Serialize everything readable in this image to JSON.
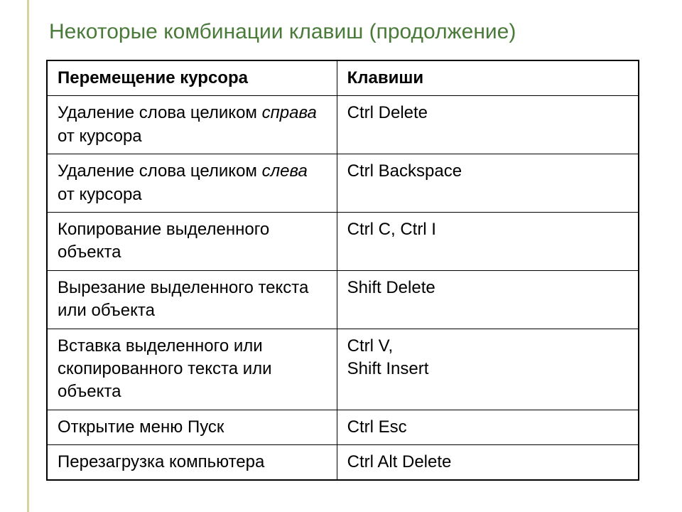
{
  "title": "Некоторые комбинации клавиш (продолжение)",
  "headers": {
    "action": "Перемещение курсора",
    "keys": "Клавиши"
  },
  "rows": [
    {
      "action_pre": "Удаление слова целиком ",
      "action_italic": "справа",
      "action_post": " от курсора",
      "keys": "Ctrl   Delete"
    },
    {
      "action_pre": "Удаление слова целиком ",
      "action_italic": "слева",
      "action_post": " от курсора",
      "keys": "Ctrl   Backspace"
    },
    {
      "action_pre": "Копирование выделенного объекта",
      "action_italic": "",
      "action_post": "",
      "keys": "Ctrl  C,    Ctrl  I"
    },
    {
      "action_pre": "Вырезание выделенного текста или объекта",
      "action_italic": "",
      "action_post": "",
      "keys": "Shift  Delete"
    },
    {
      "action_pre": "Вставка выделенного или скопированного текста или объекта",
      "action_italic": "",
      "action_post": "",
      "keys_line1": "Ctrl  V,",
      "keys_line2": "Shift  Insert"
    },
    {
      "action_pre": "Открытие меню Пуск",
      "action_italic": "",
      "action_post": "",
      "keys": "Ctrl  Esc"
    },
    {
      "action_pre": "Перезагрузка компьютера",
      "action_italic": "",
      "action_post": "",
      "keys": "Ctrl Alt Delete"
    }
  ]
}
